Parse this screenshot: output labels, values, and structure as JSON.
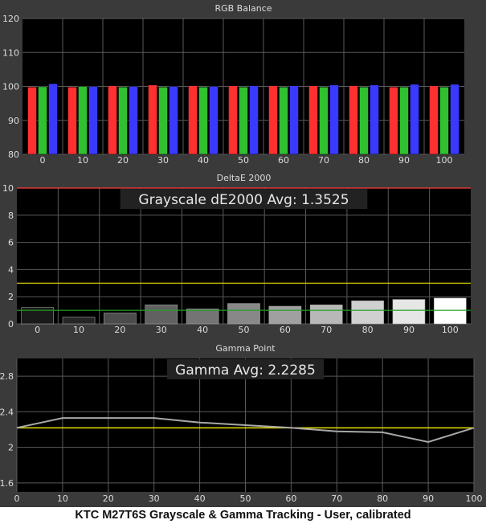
{
  "caption": "KTC M27T6S Grayscale & Gamma Tracking - User, calibrated",
  "colors": {
    "background": "#3a3a3a",
    "plot": "#000000",
    "grid": "#5a5a5a",
    "text": "#dcdcdc",
    "red": "#ff3030",
    "green": "#30c030",
    "blue": "#3a3aff",
    "limit_red": "#ff3a3a",
    "limit_yellow": "#e8e000",
    "limit_green": "#20a020",
    "gamma_line": "#a8a8a8",
    "gamma_target": "#e8e000"
  },
  "chart_data": [
    {
      "type": "bar",
      "title": "RGB Balance",
      "categories": [
        "0",
        "10",
        "20",
        "30",
        "40",
        "50",
        "60",
        "70",
        "80",
        "90",
        "100"
      ],
      "series": [
        {
          "color": "red",
          "values": [
            99.8,
            99.8,
            100.2,
            100.4,
            100.2,
            100.2,
            100.2,
            100.2,
            100.2,
            99.8,
            100.2
          ]
        },
        {
          "color": "green",
          "values": [
            99.9,
            100.0,
            99.8,
            99.8,
            99.8,
            99.8,
            99.8,
            99.8,
            99.8,
            99.8,
            99.8
          ]
        },
        {
          "color": "blue",
          "values": [
            100.8,
            100.0,
            100.0,
            100.0,
            100.0,
            100.2,
            100.2,
            100.4,
            100.4,
            100.6,
            100.6
          ]
        }
      ],
      "ylim": [
        80,
        120
      ],
      "yticks": [
        "80",
        "90",
        "100",
        "110",
        "120"
      ],
      "grid": true
    },
    {
      "type": "bar",
      "title": "DeltaE 2000",
      "annotation": "Grayscale dE2000 Avg: 1.3525",
      "categories": [
        "0",
        "10",
        "20",
        "30",
        "40",
        "50",
        "60",
        "70",
        "80",
        "90",
        "100"
      ],
      "values": [
        1.2,
        0.5,
        0.8,
        1.4,
        1.1,
        1.5,
        1.3,
        1.4,
        1.7,
        1.8,
        1.9
      ],
      "bar_colors": [
        "#1a1a1a",
        "#262626",
        "#4c4c4c",
        "#616161",
        "#747474",
        "#888888",
        "#a0a0a0",
        "#b8b8b8",
        "#d0d0d0",
        "#e6e6e6",
        "#ffffff"
      ],
      "reference_lines": [
        {
          "value": 10,
          "color": "limit_red"
        },
        {
          "value": 3,
          "color": "limit_yellow"
        },
        {
          "value": 1,
          "color": "limit_green"
        }
      ],
      "ylim": [
        0,
        10
      ],
      "yticks": [
        "0",
        "2",
        "4",
        "6",
        "8",
        "10"
      ],
      "grid": true
    },
    {
      "type": "line",
      "title": "Gamma Point",
      "annotation": "Gamma Avg: 2.2285",
      "x": [
        0,
        10,
        20,
        30,
        40,
        50,
        60,
        70,
        80,
        90,
        100
      ],
      "series": [
        {
          "color": "gamma_line",
          "values": [
            2.22,
            2.33,
            2.33,
            2.33,
            2.28,
            2.25,
            2.22,
            2.18,
            2.17,
            2.06,
            2.22
          ]
        }
      ],
      "target": 2.22,
      "xlim": [
        0,
        100
      ],
      "xticks": [
        "0",
        "10",
        "20",
        "30",
        "40",
        "50",
        "60",
        "70",
        "80",
        "90",
        "100"
      ],
      "ylim": [
        1.5,
        3.0
      ],
      "yticks": [
        "1.6",
        "2",
        "2.4",
        "2.8"
      ],
      "grid": true
    }
  ]
}
